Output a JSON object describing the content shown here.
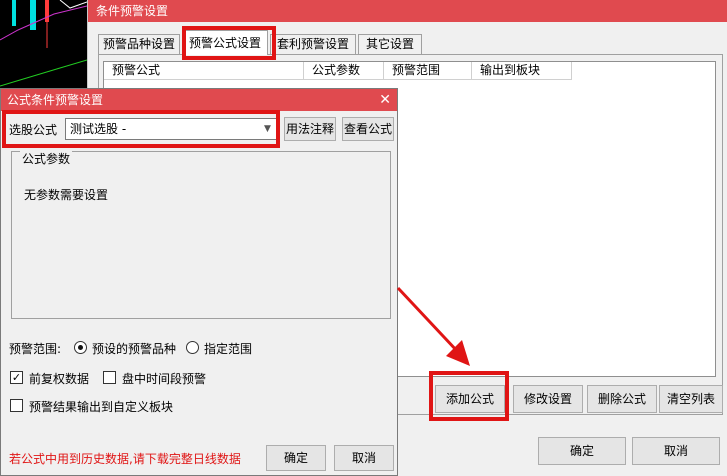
{
  "main_window": {
    "title": "条件预警设置",
    "tabs": [
      {
        "label": "预警品种设置",
        "active": false
      },
      {
        "label": "预警公式设置",
        "active": true
      },
      {
        "label": "套利预警设置",
        "active": false
      },
      {
        "label": "其它设置",
        "active": false
      }
    ],
    "columns": [
      "预警公式",
      "公式参数",
      "预警范围",
      "输出到板块"
    ],
    "buttons": {
      "add": "添加公式",
      "modify": "修改设置",
      "delete": "删除公式",
      "clear": "清空列表",
      "ok": "确定",
      "cancel": "取消"
    }
  },
  "formula_dialog": {
    "title": "公式条件预警设置",
    "close_glyph": "✕",
    "select_label": "选股公式",
    "selected_formula": "测试选股      -",
    "usage_button": "用法注释",
    "view_button": "查看公式",
    "param_group_title": "公式参数",
    "param_message": "无参数需要设置",
    "range_label": "预警范围:",
    "range_options": [
      {
        "label": "预设的预警品种",
        "checked": true
      },
      {
        "label": "指定范围",
        "checked": false
      }
    ],
    "checkboxes": [
      {
        "label": "前复权数据",
        "checked": true
      },
      {
        "label": "盘中时间段预警",
        "checked": false
      },
      {
        "label": "预警结果输出到自定义板块",
        "checked": false
      }
    ],
    "check_mark": "✓",
    "warning": "若公式中用到历史数据,请下载完整日线数据",
    "ok": "确定",
    "cancel": "取消"
  },
  "colors": {
    "title_bar": "#e04a4f",
    "highlight": "#e01515",
    "warning_text": "#e01515"
  }
}
